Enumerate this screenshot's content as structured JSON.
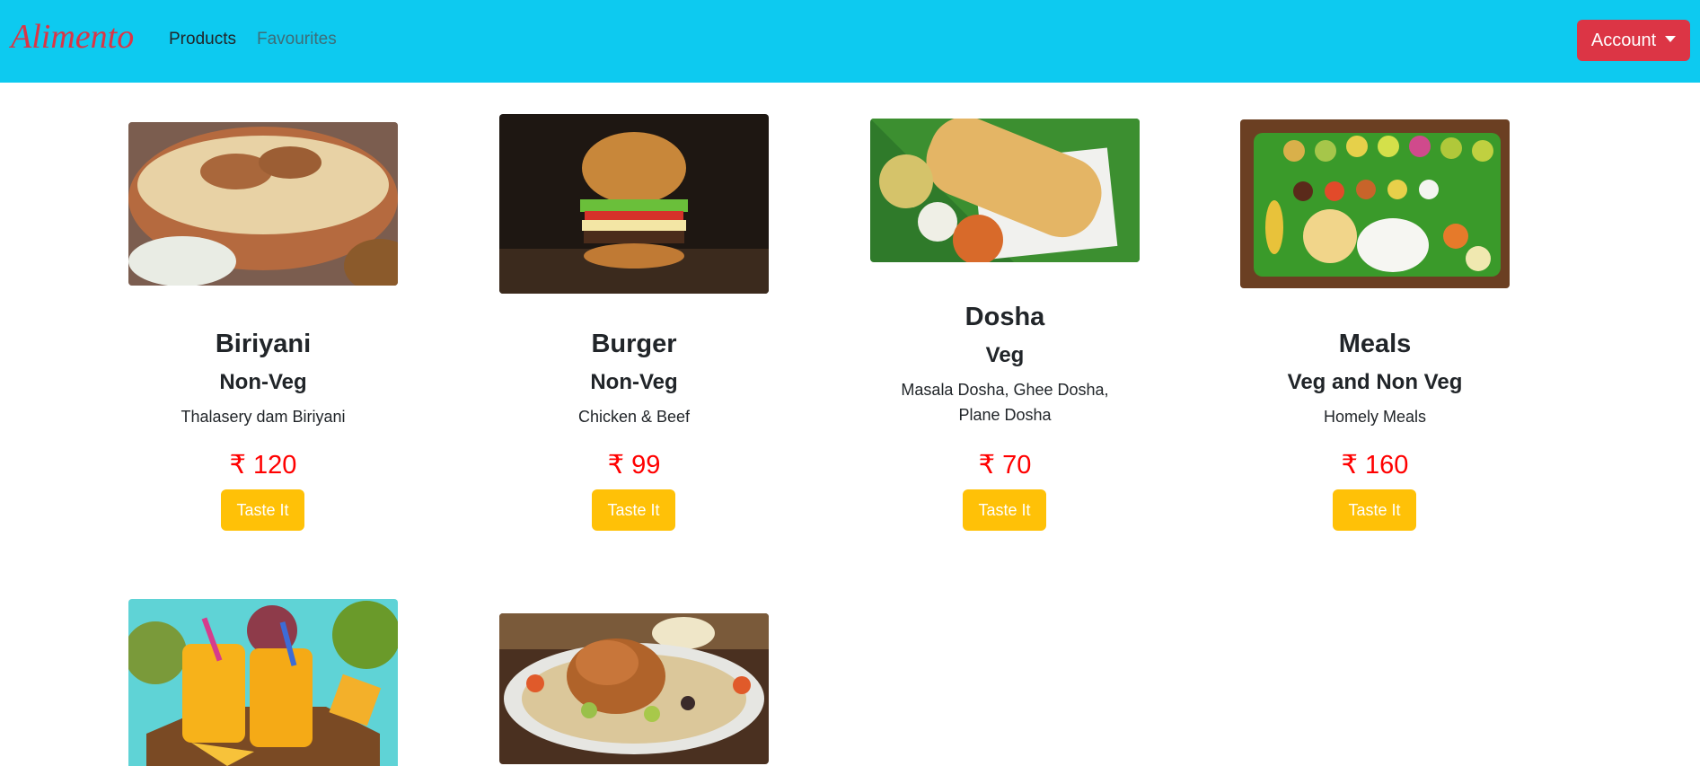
{
  "navbar": {
    "brand": "Alimento",
    "links": [
      "Products",
      "Favourites"
    ],
    "account_label": "Account"
  },
  "products": [
    {
      "title": "Biriyani",
      "category": "Non-Veg",
      "description": "Thalasery dam Biriyani",
      "price": "₹ 120",
      "button": "Taste It",
      "image_icon": "biriyani-image"
    },
    {
      "title": "Burger",
      "category": "Non-Veg",
      "description": "Chicken & Beef",
      "price": "₹ 99",
      "button": "Taste It",
      "image_icon": "burger-image"
    },
    {
      "title": "Dosha",
      "category": "Veg",
      "description": "Masala Dosha, Ghee Dosha, Plane Dosha",
      "price": "₹ 70",
      "button": "Taste It",
      "image_icon": "dosha-image"
    },
    {
      "title": "Meals",
      "category": "Veg and Non Veg",
      "description": "Homely Meals",
      "price": "₹ 160",
      "button": "Taste It",
      "image_icon": "meals-image"
    },
    {
      "image_icon": "mango-juice-image"
    },
    {
      "image_icon": "chicken-mandi-image"
    }
  ],
  "colors": {
    "navbar": "#0dcaf0",
    "brand": "#dc3545",
    "account_button": "#dc3545",
    "price": "#ff0000",
    "taste_button": "#ffc107"
  }
}
